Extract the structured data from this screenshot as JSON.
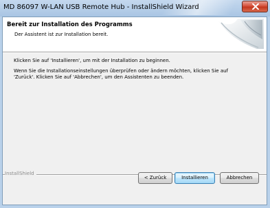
{
  "window": {
    "title": "MD 86097 W-LAN USB Remote Hub - InstallShield Wizard",
    "close_glyph": "close-icon"
  },
  "banner": {
    "title": "Bereit zur Installation des Programms",
    "subtitle": "Der Assistent ist zur Installation bereit."
  },
  "body": {
    "line1": "Klicken Sie auf 'Installieren', um mit der Installation zu beginnen.",
    "line2a": "Wenn Sie die Installationseinstellungen überprüfen oder ändern möchten, klicken Sie auf",
    "line2b": "'Zurück'. Klicken Sie auf 'Abbrechen', um den Assistenten zu beenden."
  },
  "footer": {
    "brand": "InstallShield"
  },
  "buttons": {
    "back": "< Zurück",
    "install": "Installieren",
    "cancel": "Abbrechen"
  },
  "colors": {
    "title_bar": "#b9d1ea",
    "client_bg": "#f0f0f0",
    "close_button": "#c4371e",
    "default_button_border": "#3c7fb1"
  }
}
